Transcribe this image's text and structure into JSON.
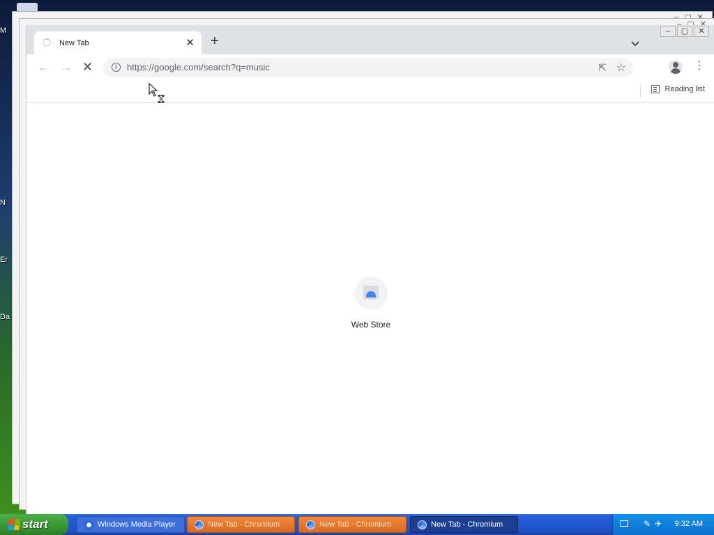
{
  "desktop": {
    "icon_labels": [
      "M",
      "N",
      "Er",
      "Da"
    ]
  },
  "browser": {
    "tab": {
      "title": "New Tab",
      "close": "✕"
    },
    "new_tab": "+",
    "tab_menu": "⌄",
    "window_controls": {
      "minimize": "–",
      "maximize": "▢",
      "close": "✕"
    },
    "toolbar": {
      "back": "←",
      "forward": "→",
      "stop": "✕",
      "url": "https://google.com/search?q=music",
      "share": "⇱",
      "star": "☆",
      "menu": "⋮"
    },
    "bookmarks": {
      "reading_list": "Reading list"
    },
    "content": {
      "shortcut_label": "Web Store"
    }
  },
  "taskbar": {
    "start_label": "start",
    "tasks": [
      {
        "label": "Windows Media Player",
        "icon": "wmp-icon"
      },
      {
        "label": "New Tab - Chromium",
        "icon": "chromium-icon"
      },
      {
        "label": "New Tab - Chromium",
        "icon": "chromium-icon"
      },
      {
        "label": "New Tab - Chromium",
        "icon": "chromium-icon"
      }
    ],
    "clock": "9:32 AM"
  },
  "colors": {
    "tab_strip": "#dee1e6",
    "omnibox": "#f1f3f4",
    "taskbar_blue": "#245edb",
    "start_green": "#3c9a35",
    "task_orange": "#d86a1e"
  }
}
